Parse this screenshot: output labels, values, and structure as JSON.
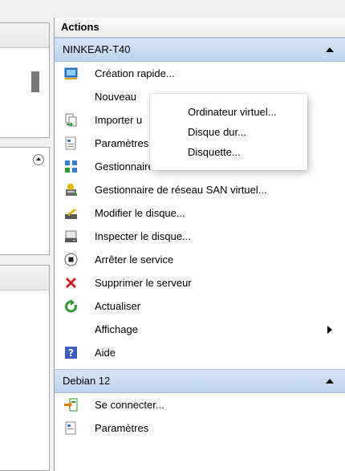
{
  "actions": {
    "title": "Actions",
    "groups": [
      {
        "name": "NINKEAR-T40",
        "items": [
          {
            "label": "Création rapide...",
            "icon": "quick-create-icon"
          },
          {
            "label": "Nouveau",
            "icon": null
          },
          {
            "label": "Importer u",
            "icon": "import-icon"
          },
          {
            "label": "Paramètres",
            "icon": "settings-icon"
          },
          {
            "label": "Gestionnaire de commutateur virtuel...",
            "icon": "virtual-switch-icon"
          },
          {
            "label": "Gestionnaire de réseau SAN virtuel...",
            "icon": "san-network-icon"
          },
          {
            "label": "Modifier le disque...",
            "icon": "edit-disk-icon"
          },
          {
            "label": "Inspecter le disque...",
            "icon": "inspect-disk-icon"
          },
          {
            "label": "Arrêter le service",
            "icon": "stop-icon"
          },
          {
            "label": "Supprimer le serveur",
            "icon": "delete-icon"
          },
          {
            "label": "Actualiser",
            "icon": "refresh-icon"
          },
          {
            "label": "Affichage",
            "icon": null
          },
          {
            "label": "Aide",
            "icon": "help-icon"
          }
        ]
      },
      {
        "name": "Debian 12",
        "items": [
          {
            "label": "Se connecter...",
            "icon": "connect-icon"
          },
          {
            "label": "Paramètres",
            "icon": "settings-icon"
          }
        ]
      }
    ]
  },
  "popup": {
    "items": [
      "Ordinateur virtuel...",
      "Disque dur...",
      "Disquette..."
    ]
  },
  "colors": {
    "group_header": "#c8dcf0",
    "delete_red": "#d11a1a",
    "refresh_green": "#2f9a2f",
    "help_blue": "#3a5fc0"
  }
}
